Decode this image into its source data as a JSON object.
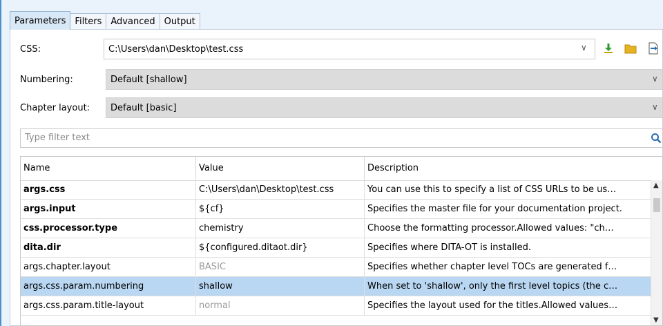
{
  "tabs": [
    {
      "label": "Parameters",
      "active": true
    },
    {
      "label": "Filters",
      "active": false
    },
    {
      "label": "Advanced",
      "active": false
    },
    {
      "label": "Output",
      "active": false
    }
  ],
  "css": {
    "label": "CSS:",
    "value": "C:\\Users\\dan\\Desktop\\test.css"
  },
  "numbering": {
    "label": "Numbering:",
    "value": "Default [shallow]"
  },
  "chapter_layout": {
    "label": "Chapter layout:",
    "value": "Default [basic]"
  },
  "filter": {
    "placeholder": "Type filter text"
  },
  "table": {
    "columns": [
      "Name",
      "Value",
      "Description"
    ],
    "rows": [
      {
        "name": "args.css",
        "value": "C:\\Users\\dan\\Desktop\\test.css",
        "description": "You can use this to specify a list of CSS URLs to be us…",
        "bold": true,
        "value_dim": false,
        "selected": false
      },
      {
        "name": "args.input",
        "value": "${cf}",
        "description": "Specifies the master file for your documentation project.",
        "bold": true,
        "value_dim": false,
        "selected": false
      },
      {
        "name": "css.processor.type",
        "value": "chemistry",
        "description": "Choose the formatting processor.Allowed values:  \"ch…",
        "bold": true,
        "value_dim": false,
        "selected": false
      },
      {
        "name": "dita.dir",
        "value": "${configured.ditaot.dir}",
        "description": "Specifies where DITA-OT is installed.",
        "bold": true,
        "value_dim": false,
        "selected": false
      },
      {
        "name": "args.chapter.layout",
        "value": "BASIC",
        "description": "Specifies whether chapter level TOCs are generated f…",
        "bold": false,
        "value_dim": true,
        "selected": false
      },
      {
        "name": "args.css.param.numbering",
        "value": "shallow",
        "description": "When set to 'shallow', only the first level topics (the c…",
        "bold": false,
        "value_dim": false,
        "selected": true
      },
      {
        "name": "args.css.param.title-layout",
        "value": "normal",
        "description": "Specifies the layout used for the titles.Allowed values…",
        "bold": false,
        "value_dim": true,
        "selected": false
      }
    ]
  },
  "colors": {
    "background": "#eaf3fb",
    "selected_row": "#b9d7f2",
    "icon_green": "#2e9b2e",
    "icon_folder": "#e6b422",
    "icon_blue": "#2b6cb0"
  }
}
